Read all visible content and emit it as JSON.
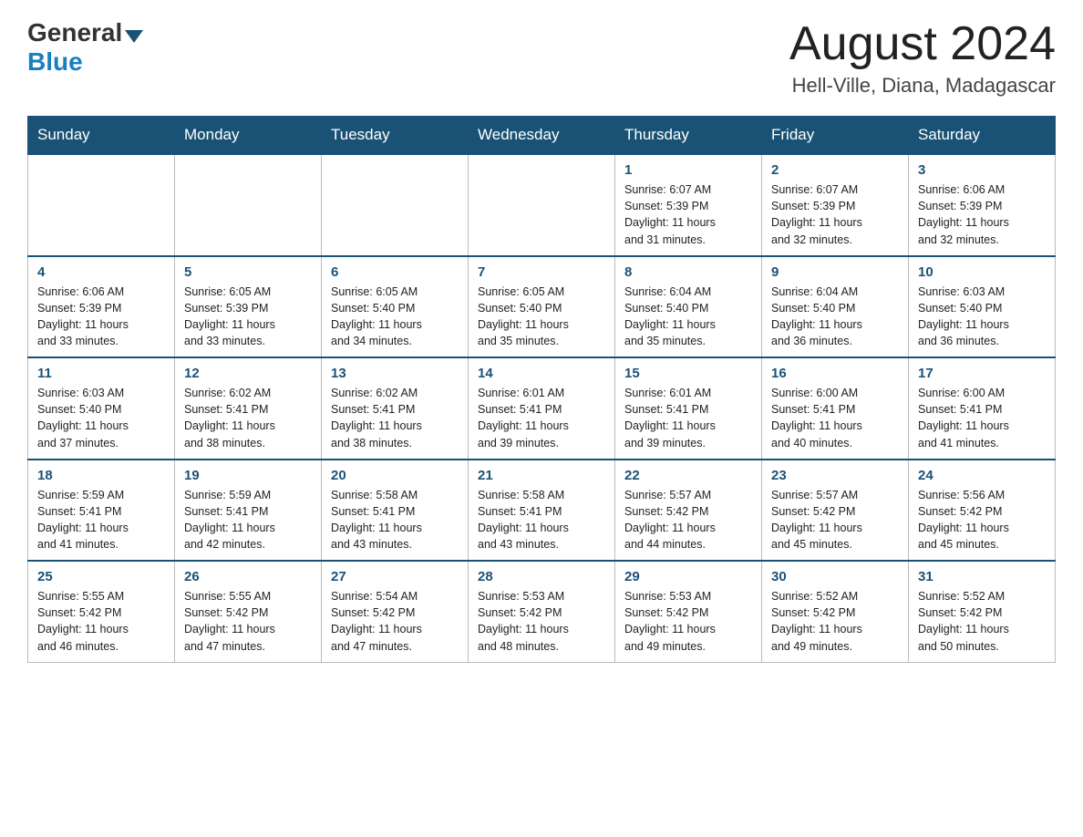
{
  "header": {
    "logo_general": "General",
    "logo_blue": "Blue",
    "month_title": "August 2024",
    "location": "Hell-Ville, Diana, Madagascar"
  },
  "days_of_week": [
    "Sunday",
    "Monday",
    "Tuesday",
    "Wednesday",
    "Thursday",
    "Friday",
    "Saturday"
  ],
  "weeks": [
    [
      {
        "day": "",
        "info": ""
      },
      {
        "day": "",
        "info": ""
      },
      {
        "day": "",
        "info": ""
      },
      {
        "day": "",
        "info": ""
      },
      {
        "day": "1",
        "info": "Sunrise: 6:07 AM\nSunset: 5:39 PM\nDaylight: 11 hours\nand 31 minutes."
      },
      {
        "day": "2",
        "info": "Sunrise: 6:07 AM\nSunset: 5:39 PM\nDaylight: 11 hours\nand 32 minutes."
      },
      {
        "day": "3",
        "info": "Sunrise: 6:06 AM\nSunset: 5:39 PM\nDaylight: 11 hours\nand 32 minutes."
      }
    ],
    [
      {
        "day": "4",
        "info": "Sunrise: 6:06 AM\nSunset: 5:39 PM\nDaylight: 11 hours\nand 33 minutes."
      },
      {
        "day": "5",
        "info": "Sunrise: 6:05 AM\nSunset: 5:39 PM\nDaylight: 11 hours\nand 33 minutes."
      },
      {
        "day": "6",
        "info": "Sunrise: 6:05 AM\nSunset: 5:40 PM\nDaylight: 11 hours\nand 34 minutes."
      },
      {
        "day": "7",
        "info": "Sunrise: 6:05 AM\nSunset: 5:40 PM\nDaylight: 11 hours\nand 35 minutes."
      },
      {
        "day": "8",
        "info": "Sunrise: 6:04 AM\nSunset: 5:40 PM\nDaylight: 11 hours\nand 35 minutes."
      },
      {
        "day": "9",
        "info": "Sunrise: 6:04 AM\nSunset: 5:40 PM\nDaylight: 11 hours\nand 36 minutes."
      },
      {
        "day": "10",
        "info": "Sunrise: 6:03 AM\nSunset: 5:40 PM\nDaylight: 11 hours\nand 36 minutes."
      }
    ],
    [
      {
        "day": "11",
        "info": "Sunrise: 6:03 AM\nSunset: 5:40 PM\nDaylight: 11 hours\nand 37 minutes."
      },
      {
        "day": "12",
        "info": "Sunrise: 6:02 AM\nSunset: 5:41 PM\nDaylight: 11 hours\nand 38 minutes."
      },
      {
        "day": "13",
        "info": "Sunrise: 6:02 AM\nSunset: 5:41 PM\nDaylight: 11 hours\nand 38 minutes."
      },
      {
        "day": "14",
        "info": "Sunrise: 6:01 AM\nSunset: 5:41 PM\nDaylight: 11 hours\nand 39 minutes."
      },
      {
        "day": "15",
        "info": "Sunrise: 6:01 AM\nSunset: 5:41 PM\nDaylight: 11 hours\nand 39 minutes."
      },
      {
        "day": "16",
        "info": "Sunrise: 6:00 AM\nSunset: 5:41 PM\nDaylight: 11 hours\nand 40 minutes."
      },
      {
        "day": "17",
        "info": "Sunrise: 6:00 AM\nSunset: 5:41 PM\nDaylight: 11 hours\nand 41 minutes."
      }
    ],
    [
      {
        "day": "18",
        "info": "Sunrise: 5:59 AM\nSunset: 5:41 PM\nDaylight: 11 hours\nand 41 minutes."
      },
      {
        "day": "19",
        "info": "Sunrise: 5:59 AM\nSunset: 5:41 PM\nDaylight: 11 hours\nand 42 minutes."
      },
      {
        "day": "20",
        "info": "Sunrise: 5:58 AM\nSunset: 5:41 PM\nDaylight: 11 hours\nand 43 minutes."
      },
      {
        "day": "21",
        "info": "Sunrise: 5:58 AM\nSunset: 5:41 PM\nDaylight: 11 hours\nand 43 minutes."
      },
      {
        "day": "22",
        "info": "Sunrise: 5:57 AM\nSunset: 5:42 PM\nDaylight: 11 hours\nand 44 minutes."
      },
      {
        "day": "23",
        "info": "Sunrise: 5:57 AM\nSunset: 5:42 PM\nDaylight: 11 hours\nand 45 minutes."
      },
      {
        "day": "24",
        "info": "Sunrise: 5:56 AM\nSunset: 5:42 PM\nDaylight: 11 hours\nand 45 minutes."
      }
    ],
    [
      {
        "day": "25",
        "info": "Sunrise: 5:55 AM\nSunset: 5:42 PM\nDaylight: 11 hours\nand 46 minutes."
      },
      {
        "day": "26",
        "info": "Sunrise: 5:55 AM\nSunset: 5:42 PM\nDaylight: 11 hours\nand 47 minutes."
      },
      {
        "day": "27",
        "info": "Sunrise: 5:54 AM\nSunset: 5:42 PM\nDaylight: 11 hours\nand 47 minutes."
      },
      {
        "day": "28",
        "info": "Sunrise: 5:53 AM\nSunset: 5:42 PM\nDaylight: 11 hours\nand 48 minutes."
      },
      {
        "day": "29",
        "info": "Sunrise: 5:53 AM\nSunset: 5:42 PM\nDaylight: 11 hours\nand 49 minutes."
      },
      {
        "day": "30",
        "info": "Sunrise: 5:52 AM\nSunset: 5:42 PM\nDaylight: 11 hours\nand 49 minutes."
      },
      {
        "day": "31",
        "info": "Sunrise: 5:52 AM\nSunset: 5:42 PM\nDaylight: 11 hours\nand 50 minutes."
      }
    ]
  ]
}
